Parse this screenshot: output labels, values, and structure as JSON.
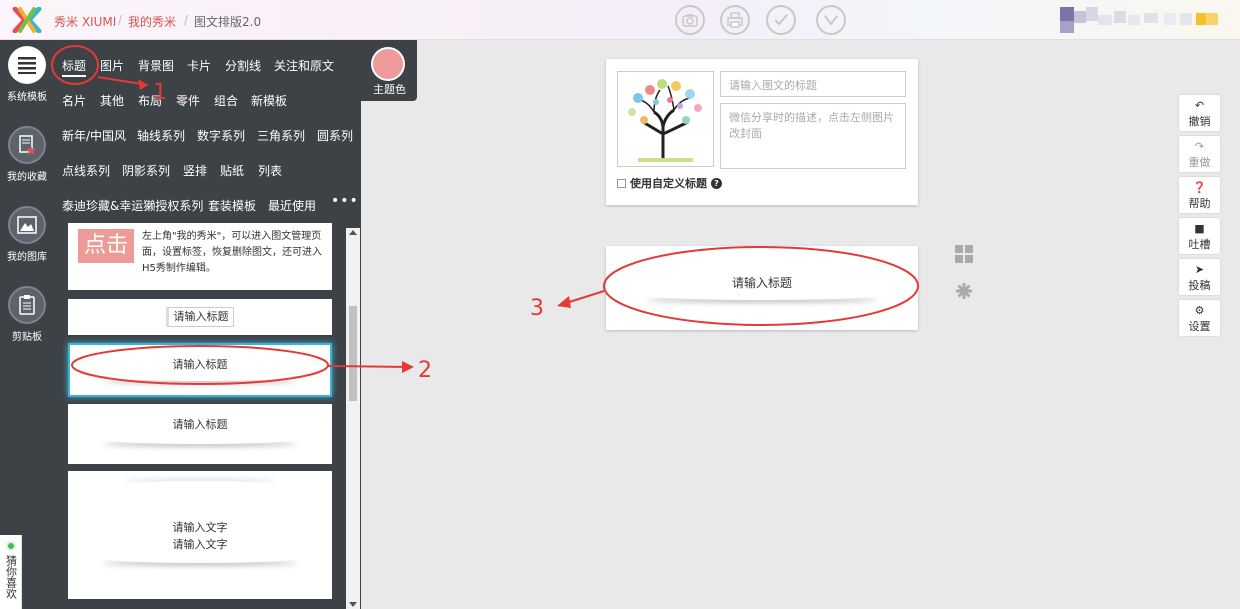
{
  "header": {
    "breadcrumb": [
      {
        "label": "秀米 XIUMI",
        "type": "link"
      },
      {
        "label": "我的秀米",
        "type": "link"
      },
      {
        "label": "图文排版2.0",
        "type": "current"
      }
    ],
    "separator": "/",
    "toolbar_icons": [
      "camera-icon",
      "print-icon",
      "check-icon",
      "chevron-down-icon"
    ]
  },
  "rail": {
    "items": [
      {
        "label": "系统模板",
        "icon": "list-icon",
        "active": true
      },
      {
        "label": "我的收藏",
        "icon": "star-doc-icon",
        "active": false
      },
      {
        "label": "我的图库",
        "icon": "image-icon",
        "active": false
      },
      {
        "label": "剪贴板",
        "icon": "clipboard-icon",
        "active": false
      }
    ],
    "guess_label": "猜你喜欢"
  },
  "categories": {
    "row1": [
      "标题",
      "图片",
      "背景图",
      "卡片",
      "分割线",
      "关注和原文"
    ],
    "row2": [
      "名片",
      "其他",
      "布局",
      "零件",
      "组合",
      "新模板"
    ],
    "row3": [
      "新年/中国风",
      "轴线系列",
      "数字系列",
      "三角系列",
      "圆系列"
    ],
    "row4": [
      "点线系列",
      "阴影系列",
      "竖排",
      "贴纸",
      "列表"
    ],
    "row5": [
      "泰迪珍藏&幸运獭授权系列",
      "套装模板",
      "最近使用"
    ],
    "more": "•••",
    "active": "标题",
    "theme_color_label": "主题色",
    "theme_color": "#ef9a9a"
  },
  "templates": {
    "intro": {
      "badge": "点击",
      "text": "左上角\"我的秀米\"，可以进入图文管理页面，设置标签，恢复删除图文，还可进入H5秀制作编辑。"
    },
    "t1": "请输入标题",
    "t2": "请输入标题",
    "t3": "请输入标题",
    "t4_line1": "请输入文字",
    "t4_line2": "请输入文字"
  },
  "editor": {
    "title_placeholder": "请输入图文的标题",
    "desc_placeholder": "微信分享时的描述，点击左侧图片改封面",
    "custom_title_label": "使用自定义标题",
    "help_mark": "?",
    "inserted_title": "请输入标题"
  },
  "right_toolbar": [
    {
      "label": "撤销",
      "icon": "undo-icon",
      "enabled": true
    },
    {
      "label": "重做",
      "icon": "redo-icon",
      "enabled": false
    },
    {
      "label": "帮助",
      "icon": "help-icon",
      "enabled": true
    },
    {
      "label": "吐槽",
      "icon": "comment-icon",
      "enabled": true
    },
    {
      "label": "投稿",
      "icon": "send-icon",
      "enabled": true
    },
    {
      "label": "设置",
      "icon": "gear-icon",
      "enabled": true
    }
  ],
  "annotations": {
    "n1": "1",
    "n2": "2",
    "n3": "3"
  },
  "colors": {
    "accent": "#d9534f",
    "panel": "#3d4247",
    "annotation": "#e53935"
  }
}
